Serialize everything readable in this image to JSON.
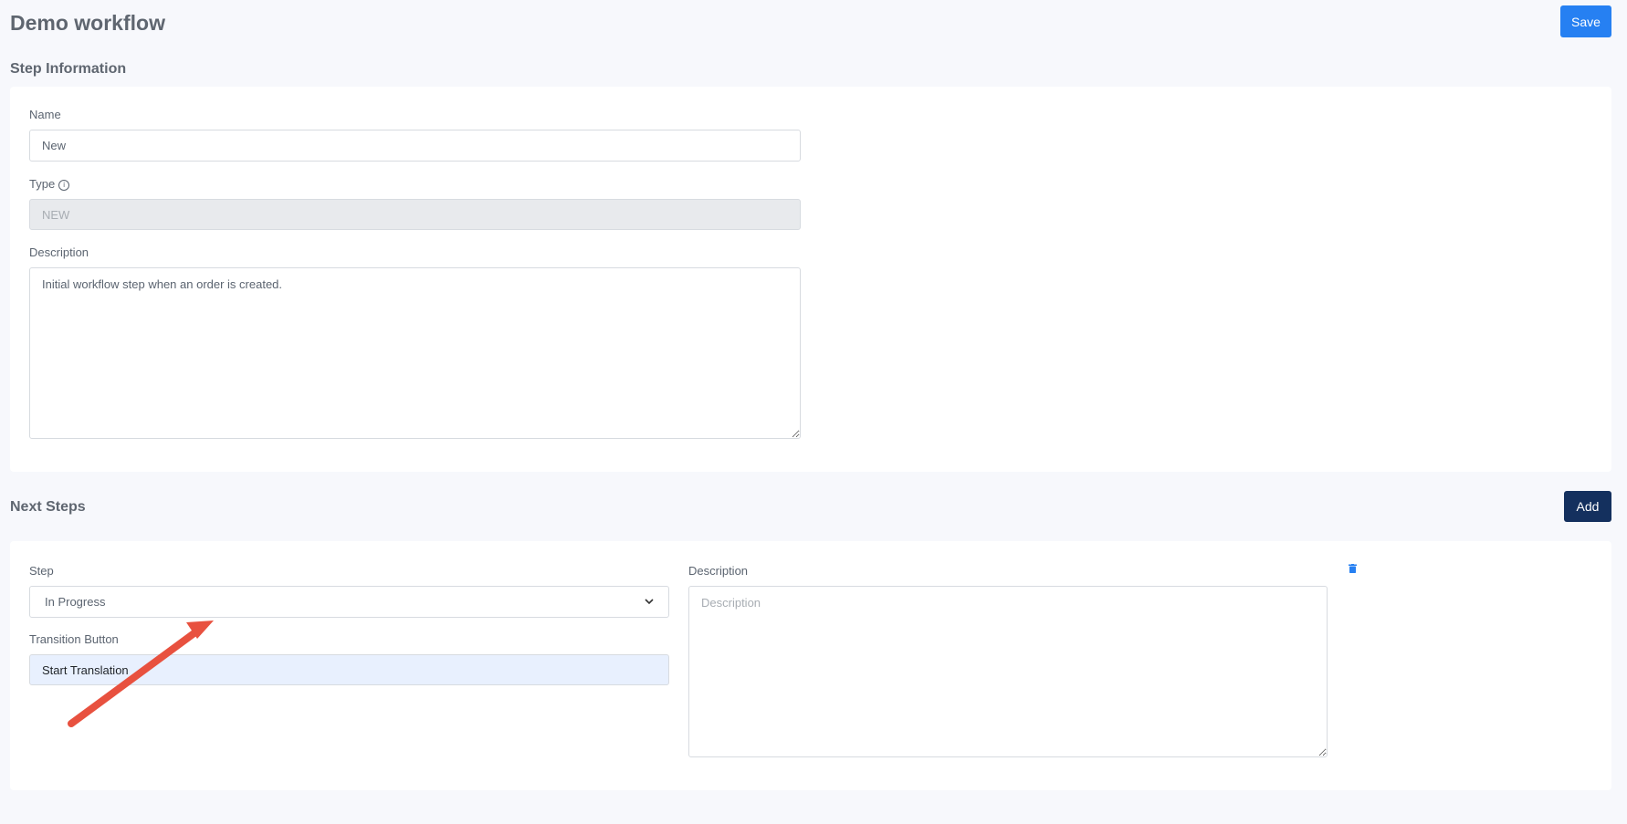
{
  "header": {
    "title": "Demo workflow",
    "save_label": "Save"
  },
  "step_information": {
    "section_title": "Step Information",
    "name": {
      "label": "Name",
      "value": "New"
    },
    "type": {
      "label": "Type",
      "value": "NEW",
      "info_icon": "info-icon"
    },
    "description": {
      "label": "Description",
      "value": "Initial workflow step when an order is created."
    }
  },
  "next_steps": {
    "section_title": "Next Steps",
    "add_label": "Add",
    "items": [
      {
        "step": {
          "label": "Step",
          "selected": "In Progress"
        },
        "transition_button": {
          "label": "Transition Button",
          "value": "Start Translation"
        },
        "description": {
          "label": "Description",
          "placeholder": "Description",
          "value": ""
        },
        "delete_icon": "trash-icon"
      }
    ]
  },
  "colors": {
    "primary": "#2680f2",
    "dark_button": "#14305e",
    "annotation_arrow": "#e8513f",
    "background": "#f7f8fc"
  }
}
